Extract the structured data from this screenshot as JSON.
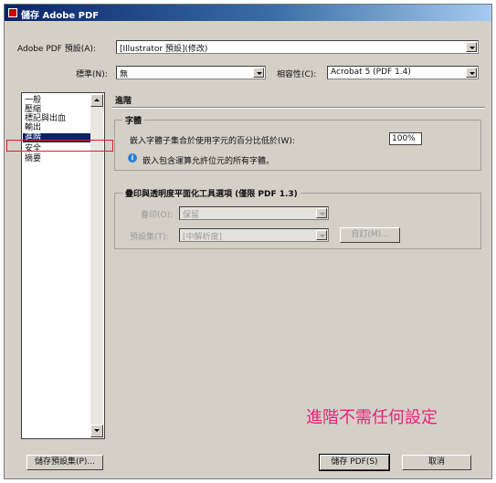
{
  "window": {
    "title": "儲存 Adobe PDF"
  },
  "preset": {
    "label": "Adobe PDF 預設(A):",
    "value": "[Illustrator 預設](修改)"
  },
  "standard": {
    "label": "標準(N):",
    "value": "無"
  },
  "compat": {
    "label": "相容性(C):",
    "value": "Acrobat 5 (PDF 1.4)"
  },
  "sidebar": {
    "items": [
      {
        "label": "一般"
      },
      {
        "label": "壓縮"
      },
      {
        "label": "標記與出血"
      },
      {
        "label": "輸出"
      },
      {
        "label": "進階",
        "selected": true
      },
      {
        "label": "安全"
      },
      {
        "label": "摘要"
      }
    ]
  },
  "panel": {
    "title": "進階",
    "fonts": {
      "group_title": "字體",
      "subset_label": "嵌入字體子集合於使用字元的百分比低於(W):",
      "subset_value": "100%",
      "info_text": "嵌入包含運算允許位元的所有字體。"
    },
    "flatten": {
      "group_title": "疊印與透明度平面化工具選項 (僅限 PDF 1.3)",
      "overprint_label": "疊印(O):",
      "overprint_value": "保留",
      "preset_label": "預設集(T):",
      "preset_value": "[中解析度]",
      "custom_button": "自訂(M)..."
    }
  },
  "annotation": {
    "text": "進階不需任何設定"
  },
  "footer": {
    "save_preset_button": "儲存預設集(P)...",
    "save_pdf_button": "儲存 PDF(S)",
    "cancel_button": "取消"
  },
  "colors": {
    "titlebar": "#0a246a",
    "selection": "#0a246a",
    "annotation": "#e8237a",
    "highlight_box": "#e01b24"
  }
}
